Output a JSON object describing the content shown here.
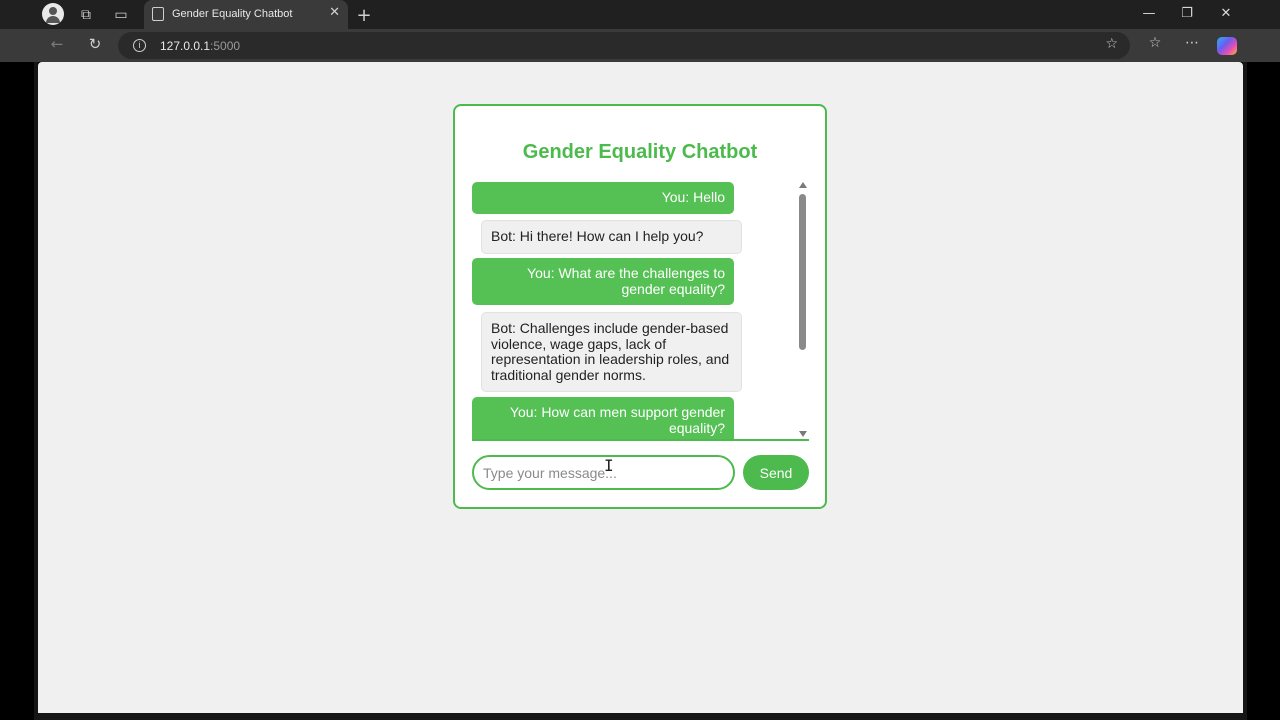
{
  "browser": {
    "tab_title": "Gender Equality Chatbot",
    "tab_close": "✕",
    "new_tab": "+",
    "url_host": "127.0.0.1",
    "url_port": ":5000",
    "icons": {
      "profile": "profile-icon",
      "workspaces": "workspaces-icon",
      "tab_actions": "tab-actions-icon",
      "favicon": "page-icon",
      "back": "back-arrow-icon",
      "reload": "reload-icon",
      "info": "info-icon",
      "favorite": "star-icon",
      "favorites": "favorites-icon",
      "more": "more-icon",
      "copilot": "copilot-icon"
    },
    "window": {
      "minimize": "—",
      "restore": "❐",
      "close": "✕"
    }
  },
  "chat": {
    "title": "Gender Equality Chatbot",
    "messages": [
      {
        "sender": "user",
        "text": "You: Hello"
      },
      {
        "sender": "bot",
        "text": "Bot: Hi there! How can I help you?"
      },
      {
        "sender": "user",
        "text": "You: What are the challenges to gender equality?"
      },
      {
        "sender": "bot",
        "text": "Bot: Challenges include gender-based violence, wage gaps, lack of representation in leadership roles, and traditional gender norms."
      },
      {
        "sender": "user",
        "text": "You: How can men support gender equality?"
      }
    ],
    "input": {
      "placeholder": "Type your message...",
      "value": ""
    },
    "send_label": "Send"
  },
  "colors": {
    "accent": "#4cba4c",
    "user_bubble": "#55c155",
    "bot_bubble": "#f0f0f0",
    "page_bg": "#f0f0f0"
  }
}
